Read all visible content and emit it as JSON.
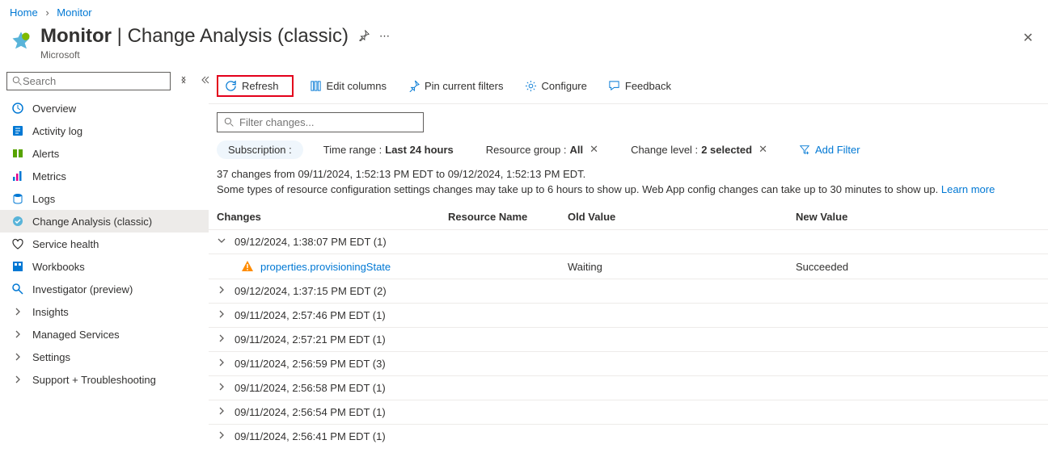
{
  "breadcrumb": {
    "home": "Home",
    "monitor": "Monitor"
  },
  "header": {
    "title_main": "Monitor",
    "title_sep": " | ",
    "title_sub": "Change Analysis (classic)",
    "publisher": "Microsoft"
  },
  "sidebar": {
    "search_placeholder": "Search",
    "items": [
      {
        "label": "Overview",
        "icon": "monitor-overview",
        "type": "icon"
      },
      {
        "label": "Activity log",
        "icon": "activity-log",
        "type": "icon"
      },
      {
        "label": "Alerts",
        "icon": "alerts",
        "type": "icon"
      },
      {
        "label": "Metrics",
        "icon": "metrics",
        "type": "icon"
      },
      {
        "label": "Logs",
        "icon": "logs",
        "type": "icon"
      },
      {
        "label": "Change Analysis (classic)",
        "icon": "change-analysis",
        "type": "icon",
        "selected": true
      },
      {
        "label": "Service health",
        "icon": "service-health",
        "type": "icon"
      },
      {
        "label": "Workbooks",
        "icon": "workbooks",
        "type": "icon"
      },
      {
        "label": "Investigator (preview)",
        "icon": "investigator",
        "type": "icon"
      },
      {
        "label": "Insights",
        "icon": "chevron",
        "type": "chev"
      },
      {
        "label": "Managed Services",
        "icon": "chevron",
        "type": "chev"
      },
      {
        "label": "Settings",
        "icon": "chevron",
        "type": "chev"
      },
      {
        "label": "Support + Troubleshooting",
        "icon": "chevron",
        "type": "chev"
      }
    ]
  },
  "toolbar": {
    "refresh": "Refresh",
    "edit_columns": "Edit columns",
    "pin_filters": "Pin current filters",
    "configure": "Configure",
    "feedback": "Feedback"
  },
  "filter_placeholder": "Filter changes...",
  "pills": {
    "subscription_label": "Subscription :",
    "time_label": "Time range : ",
    "time_value": "Last 24 hours",
    "rg_label": "Resource group : ",
    "rg_value": "All",
    "cl_label": "Change level : ",
    "cl_value": "2 selected",
    "add_filter": "Add Filter"
  },
  "summary": "37 changes from 09/11/2024, 1:52:13 PM EDT to 09/12/2024, 1:52:13 PM EDT.",
  "note_text": "Some types of resource configuration settings changes may take up to 6 hours to show up. Web App config changes can take up to 30 minutes to show up. ",
  "note_link": "Learn more",
  "columns": {
    "changes": "Changes",
    "resource": "Resource Name",
    "old": "Old Value",
    "new": "New Value"
  },
  "groups": [
    {
      "ts": "09/12/2024, 1:38:07 PM EDT (1)",
      "expanded": true,
      "detail": {
        "prop": "properties.provisioningState",
        "old": "Waiting",
        "new": "Succeeded"
      }
    },
    {
      "ts": "09/12/2024, 1:37:15 PM EDT (2)",
      "expanded": false
    },
    {
      "ts": "09/11/2024, 2:57:46 PM EDT (1)",
      "expanded": false
    },
    {
      "ts": "09/11/2024, 2:57:21 PM EDT (1)",
      "expanded": false
    },
    {
      "ts": "09/11/2024, 2:56:59 PM EDT (3)",
      "expanded": false
    },
    {
      "ts": "09/11/2024, 2:56:58 PM EDT (1)",
      "expanded": false
    },
    {
      "ts": "09/11/2024, 2:56:54 PM EDT (1)",
      "expanded": false
    },
    {
      "ts": "09/11/2024, 2:56:41 PM EDT (1)",
      "expanded": false
    }
  ]
}
